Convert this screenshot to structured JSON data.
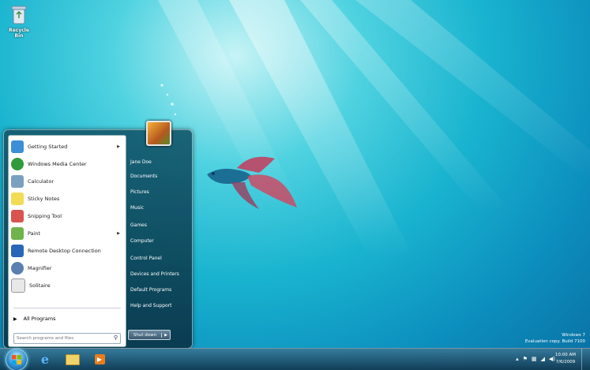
{
  "desktop": {
    "recycle_bin_label": "Recycle Bin"
  },
  "start_menu": {
    "programs": [
      {
        "label": "Getting Started",
        "icon": "getting-started-icon",
        "has_submenu": true,
        "color": "#3c8fd6"
      },
      {
        "label": "Windows Media Center",
        "icon": "media-center-icon",
        "has_submenu": false,
        "color": "#2f9b3a"
      },
      {
        "label": "Calculator",
        "icon": "calculator-icon",
        "has_submenu": false,
        "color": "#7aa0c0"
      },
      {
        "label": "Sticky Notes",
        "icon": "sticky-notes-icon",
        "has_submenu": false,
        "color": "#f2dc53"
      },
      {
        "label": "Snipping Tool",
        "icon": "snipping-tool-icon",
        "has_submenu": false,
        "color": "#d9534f"
      },
      {
        "label": "Paint",
        "icon": "paint-icon",
        "has_submenu": true,
        "color": "#6fb34a"
      },
      {
        "label": "Remote Desktop Connection",
        "icon": "remote-desktop-icon",
        "has_submenu": false,
        "color": "#2a66b8"
      },
      {
        "label": "Magnifier",
        "icon": "magnifier-icon",
        "has_submenu": false,
        "color": "#5a7fb0"
      },
      {
        "label": "Solitaire",
        "icon": "solitaire-icon",
        "has_submenu": false,
        "color": "#e8e8e8"
      }
    ],
    "all_programs_label": "All Programs",
    "search_placeholder": "Search programs and files",
    "right_links": [
      "Jane Doe",
      "Documents",
      "Pictures",
      "Music",
      "Games",
      "Computer",
      "Control Panel",
      "Devices and Printers",
      "Default Programs",
      "Help and Support"
    ],
    "shutdown_label": "Shut down"
  },
  "watermark": {
    "line1": "Windows 7",
    "line2": "Evaluation copy. Build 7100"
  },
  "taskbar": {
    "pinned": [
      "internet-explorer-icon",
      "windows-explorer-icon",
      "media-player-icon"
    ],
    "clock_time": "10:00 AM",
    "clock_date": "7/6/2009"
  }
}
